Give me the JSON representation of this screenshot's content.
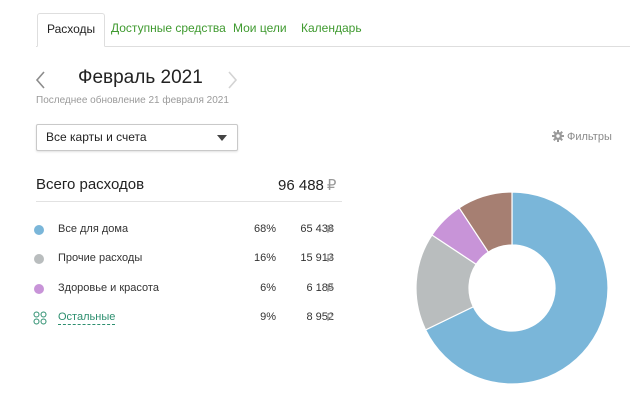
{
  "tabs": [
    {
      "label": "Расходы",
      "active": true
    },
    {
      "label": "Доступные средства",
      "active": false
    },
    {
      "label": "Мои цели",
      "active": false
    },
    {
      "label": "Календарь",
      "active": false
    }
  ],
  "period": {
    "title": "Февраль 2021",
    "updated": "Последнее обновление 21 февраля 2021"
  },
  "dropdown": {
    "selected": "Все карты и счета"
  },
  "filters": {
    "label": "Фильтры",
    "icon": "gear-icon"
  },
  "summary": {
    "label": "Всего расходов",
    "value": "96 488",
    "currency": "₽"
  },
  "categories": [
    {
      "name": "Все для дома",
      "percent": "68%",
      "amount": "65 438",
      "currency": "₽",
      "color": "#7ab6d9"
    },
    {
      "name": "Прочие расходы",
      "percent": "16%",
      "amount": "15 913",
      "currency": "₽",
      "color": "#b9bdbe"
    },
    {
      "name": "Здоровье и красота",
      "percent": "6%",
      "amount": "6 185",
      "currency": "₽",
      "color": "#c894d8"
    },
    {
      "name": "Остальные",
      "percent": "9%",
      "amount": "8 952",
      "currency": "₽",
      "color": "#a67f72"
    }
  ],
  "chart_data": {
    "type": "pie",
    "style": "donut",
    "slices": [
      {
        "label": "Все для дома",
        "value": 65438,
        "color": "#7ab6d9"
      },
      {
        "label": "Прочие расходы",
        "value": 15913,
        "color": "#b9bdbe"
      },
      {
        "label": "Здоровье и красота",
        "value": 6185,
        "color": "#c894d8"
      },
      {
        "label": "Остальные",
        "value": 8952,
        "color": "#a67f72"
      }
    ]
  }
}
